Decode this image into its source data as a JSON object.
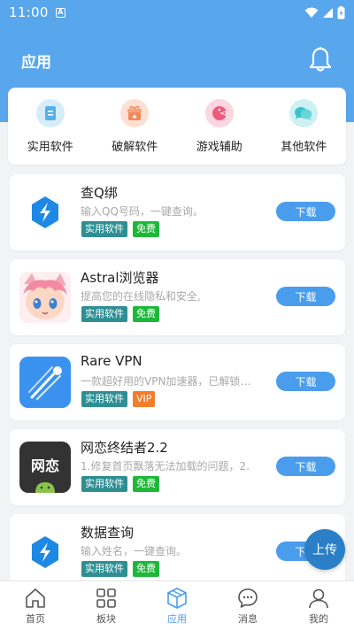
{
  "status_bar": {
    "time": "11:00",
    "sim_icon": "A"
  },
  "header": {
    "title": "应用"
  },
  "categories": [
    {
      "label": "实用软件",
      "icon": "document-icon",
      "color": "#56b0e8"
    },
    {
      "label": "破解软件",
      "icon": "gift-icon",
      "color": "#f0885a"
    },
    {
      "label": "游戏辅助",
      "icon": "pacman-icon",
      "color": "#ec5a7c"
    },
    {
      "label": "其他软件",
      "icon": "chat-bubbles-icon",
      "color": "#39c3c9"
    }
  ],
  "apps": [
    {
      "name": "查Q绑",
      "desc": "输入QQ号码，一键查询。",
      "tags": [
        "实用软件",
        "免费"
      ],
      "download": "下载"
    },
    {
      "name": "Astral浏览器",
      "desc": "提高您的在线隐私和安全,",
      "tags": [
        "实用软件",
        "免费"
      ],
      "download": "下载"
    },
    {
      "name": "Rare VPN",
      "desc": "一款超好用的VPN加速器，已解锁会员",
      "tags": [
        "实用软件",
        "VIP"
      ],
      "download": "下载"
    },
    {
      "name": "网恋终结者2.2",
      "desc": "1.修复首页飘落无法加载的问题，2.",
      "logo_text": "网恋",
      "tags": [
        "实用软件",
        "免费"
      ],
      "download": "下载"
    },
    {
      "name": "数据查询",
      "desc": "输入姓名，一键查询。",
      "tags": [
        "实用软件",
        "免费"
      ],
      "download": "下载"
    }
  ],
  "upload_button": "上传",
  "tabbar": [
    {
      "label": "首页",
      "icon": "home-icon"
    },
    {
      "label": "板块",
      "icon": "grid-icon"
    },
    {
      "label": "应用",
      "icon": "cube-icon",
      "active": true
    },
    {
      "label": "消息",
      "icon": "message-icon"
    },
    {
      "label": "我的",
      "icon": "user-icon"
    }
  ],
  "colors": {
    "primary": "#58a6ec",
    "button": "#4a9ded",
    "tag_category": "#2e8f93",
    "tag_free": "#1db83a",
    "tag_vip": "#f47d2c"
  }
}
